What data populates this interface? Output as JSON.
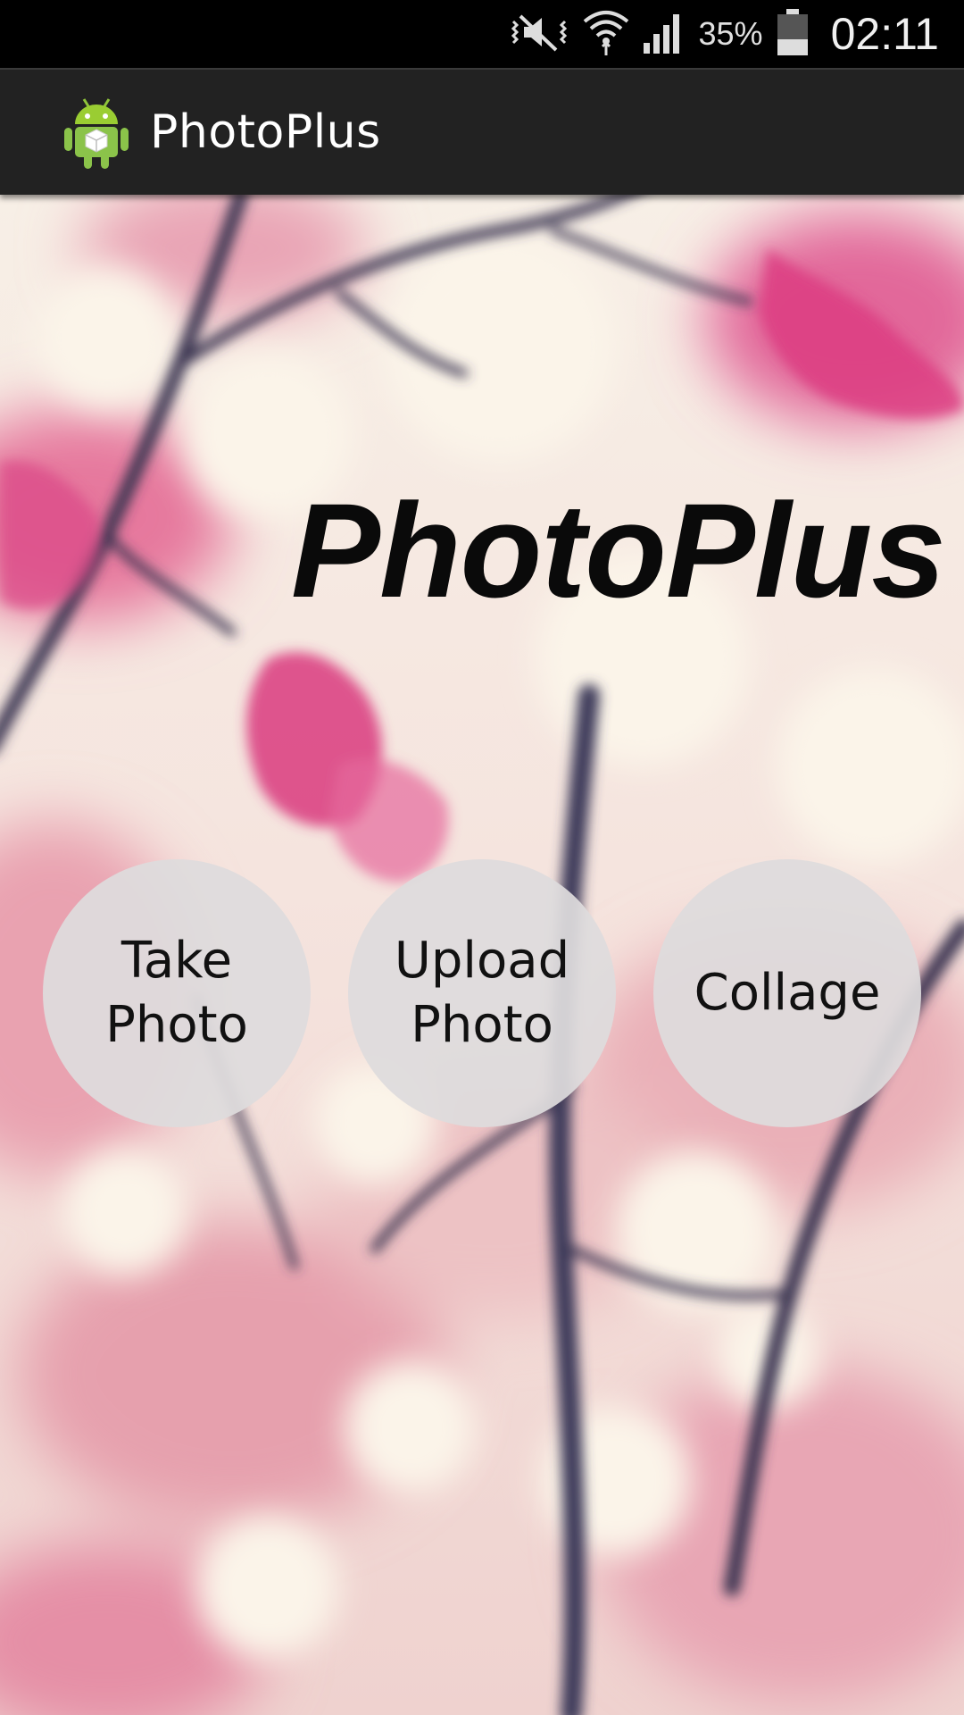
{
  "status_bar": {
    "battery_percent": "35%",
    "time": "02:11",
    "icons": [
      "mute-vibrate-icon",
      "wifi-icon",
      "signal-icon",
      "battery-icon"
    ]
  },
  "action_bar": {
    "title": "PhotoPlus",
    "icon": "android-app-icon"
  },
  "main": {
    "heading": "PhotoPlus",
    "buttons": [
      {
        "label": "Take\nPhoto"
      },
      {
        "label": "Upload\nPhoto"
      },
      {
        "label": "Collage"
      }
    ]
  },
  "colors": {
    "status_bar_bg": "#000000",
    "action_bar_bg": "#222222",
    "button_bg": "#dedcdd",
    "blossom_pink": "#e0407e",
    "branch_dark": "#3a3450"
  }
}
